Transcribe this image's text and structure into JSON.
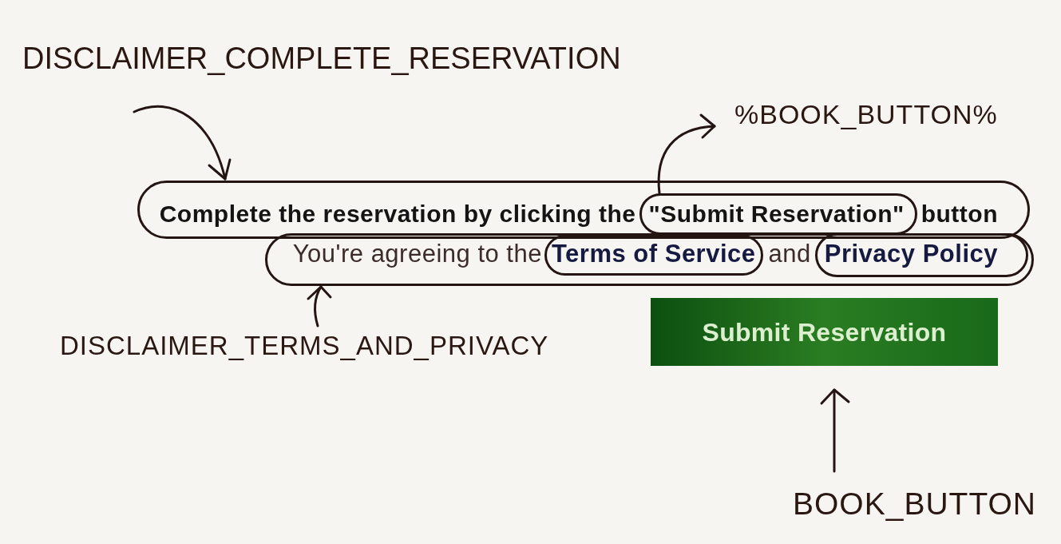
{
  "annotations": [
    {
      "text": "DISCLAIMER_COMPLETE_RESERVATION"
    },
    {
      "text": "%BOOK_BUTTON%"
    },
    {
      "text": "DISCLAIMER_TERMS_AND_PRIVACY"
    },
    {
      "text": "BOOK_BUTTON"
    }
  ],
  "form": {
    "instruction": [
      {
        "kind": "text",
        "text": "Complete the reservation by clicking the"
      },
      {
        "kind": "quote",
        "text": "\"Submit Reservation\""
      },
      {
        "kind": "text",
        "text": "button"
      }
    ],
    "agreement": [
      {
        "kind": "text",
        "text": "You're agreeing to the"
      },
      {
        "kind": "link",
        "text": "Terms of Service"
      },
      {
        "kind": "text",
        "text": "and"
      },
      {
        "kind": "link",
        "text": "Privacy Policy"
      }
    ],
    "submit_button": "Submit Reservation"
  }
}
